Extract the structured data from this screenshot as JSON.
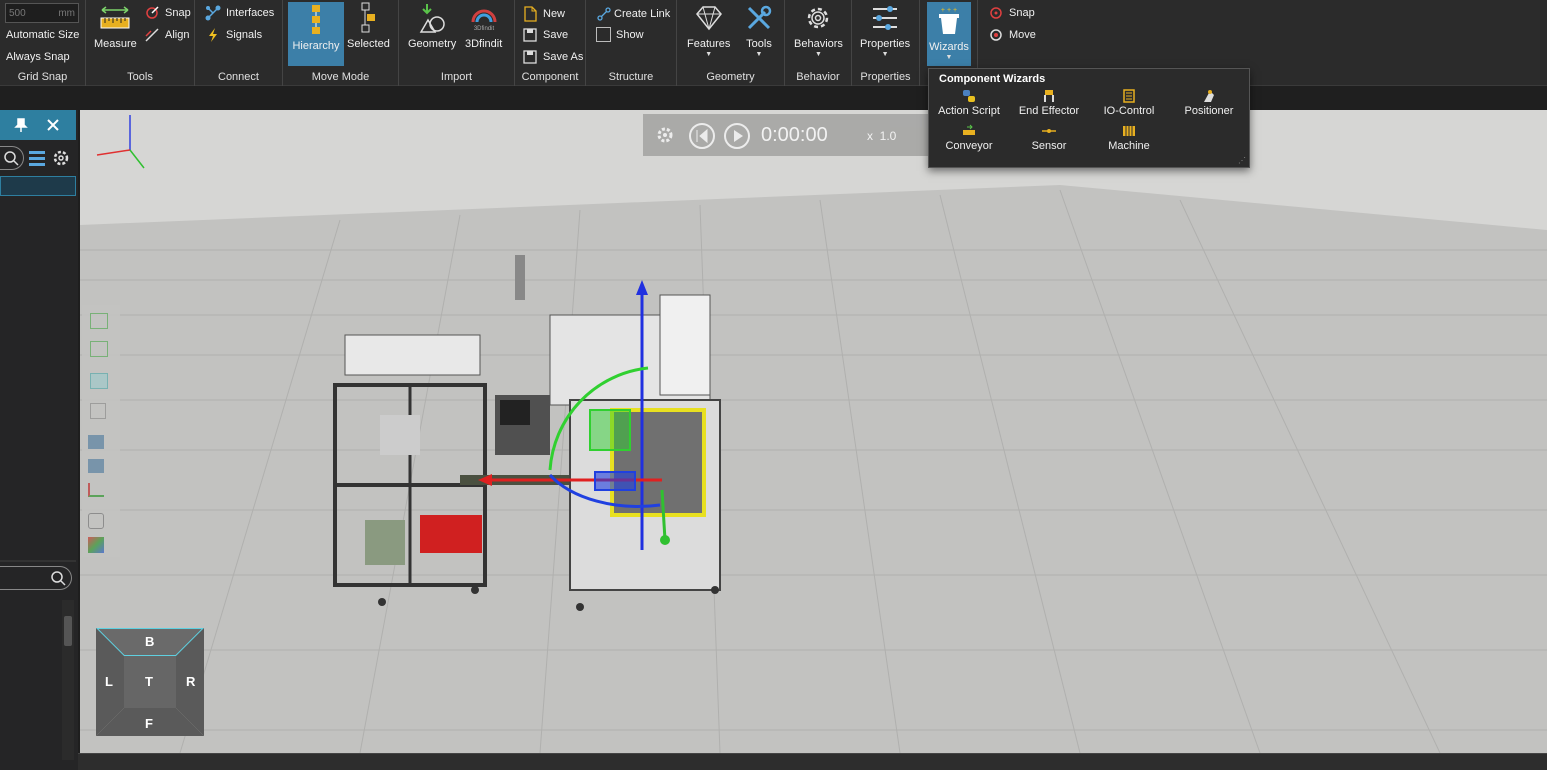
{
  "ribbon": {
    "grid_snap": {
      "size_value": "500",
      "size_unit": "mm",
      "automatic_size": "Automatic Size",
      "always_snap": "Always Snap",
      "title": "Grid Snap"
    },
    "tools": {
      "measure": "Measure",
      "snap": "Snap",
      "align": "Align",
      "title": "Tools"
    },
    "connect": {
      "interfaces": "Interfaces",
      "signals": "Signals",
      "title": "Connect"
    },
    "move_mode": {
      "hierarchy": "Hierarchy",
      "selected": "Selected",
      "title": "Move Mode"
    },
    "import": {
      "geometry": "Geometry",
      "3dfindit": "3Dfindit",
      "logo_text": "3Dfindit",
      "title": "Import"
    },
    "component": {
      "new": "New",
      "save": "Save",
      "save_as": "Save As",
      "title": "Component"
    },
    "structure": {
      "create_link": "Create Link",
      "show": "Show",
      "title": "Structure"
    },
    "geometry": {
      "features": "Features",
      "tools": "Tools",
      "title": "Geometry"
    },
    "behavior": {
      "behaviors": "Behaviors",
      "title": "Behavior"
    },
    "properties": {
      "properties": "Properties",
      "title": "Properties"
    },
    "wizards": {
      "label": "Wizards"
    },
    "snap_move": {
      "snap": "Snap",
      "move": "Move"
    }
  },
  "wizard_popup": {
    "title": "Component Wizards",
    "items": [
      "Action Script",
      "End Effector",
      "IO-Control",
      "Positioner",
      "Conveyor",
      "Sensor",
      "Machine"
    ]
  },
  "timebar": {
    "time": "0:00:00",
    "speed": "x  1.0"
  },
  "navcube": {
    "top": "B",
    "left": "L",
    "center": "T",
    "right": "R",
    "bottom": "F"
  },
  "colors": {
    "accent": "#3c7fa8",
    "ribbon_bg": "#2b2b2b",
    "viewport_bg": "#c8c8c6"
  },
  "icons": [
    "pin-icon",
    "close-icon",
    "search-icon",
    "filter-icon",
    "gear-icon",
    "play-icon",
    "rewind-icon"
  ]
}
